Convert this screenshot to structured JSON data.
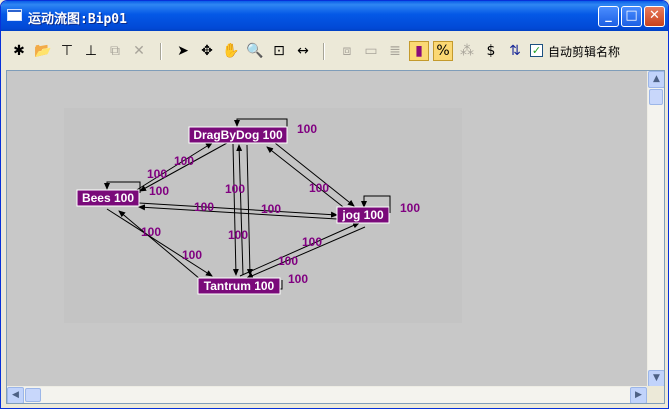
{
  "window": {
    "title": "运动流图:Bip01"
  },
  "toolbar": {
    "show_clip_names_label": "自动剪辑名称",
    "show_clip_names_checked": "✓"
  },
  "graph": {
    "nodes": {
      "dragbydog": "DragByDog 100",
      "bees": "Bees 100",
      "jog": "jog 100",
      "tantrum": "Tantrum 100"
    },
    "weights": {
      "dragbydog_self": "100",
      "bees_self": "100",
      "jog_self": "100",
      "tantrum_self": "100",
      "bees_dragbydog": "100",
      "bees_jog_upper": "100",
      "bees_jog_lower": "100",
      "dragbydog_tantrum_a": "100",
      "dragbydog_tantrum_b": "100",
      "dragbydog_jog": "100",
      "bees_tantrum": "100",
      "bees_tantrum_b": "100",
      "jog_tantrum_a": "100",
      "jog_tantrum_b": "100"
    }
  },
  "colors": {
    "node_fill": "#7a0a7a",
    "weight_text": "#800080",
    "canvas": "#c8c8c8"
  }
}
